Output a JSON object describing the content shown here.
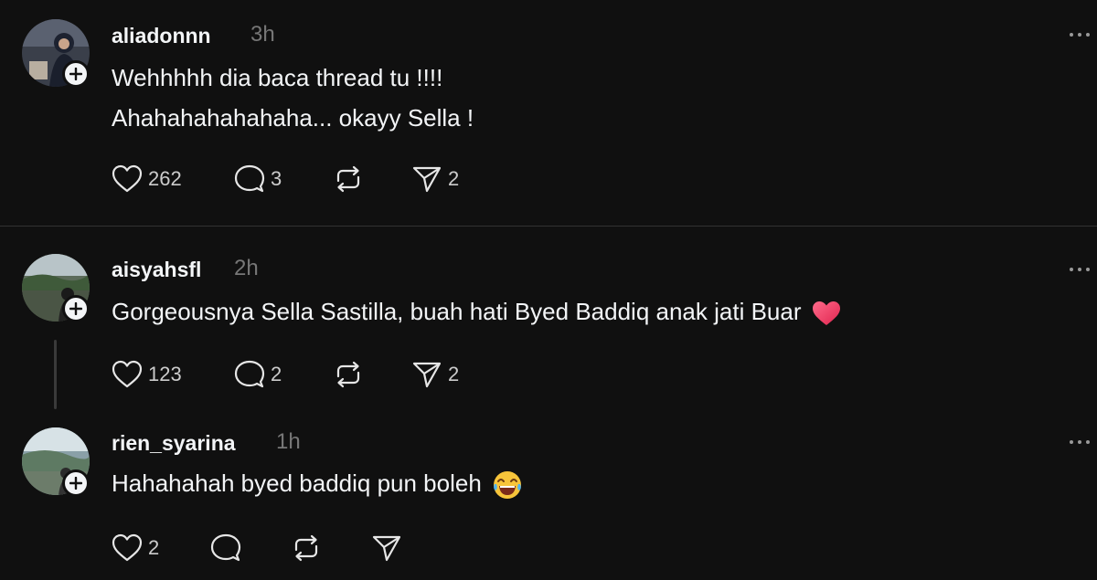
{
  "posts": [
    {
      "username": "aliadonnn",
      "time": "3h",
      "text_lines": [
        "Wehhhhh dia baca thread tu !!!!",
        "Ahahahahahahaha... okayy Sella !"
      ],
      "likes": "262",
      "replies": "3",
      "reposts": "",
      "shares": "2"
    },
    {
      "username": "aisyahsfl",
      "time": "2h",
      "text_lines": [
        "Gorgeousnya Sella Sastilla, buah hati Byed Baddiq anak jati Buar"
      ],
      "emoji": "heart-emoji",
      "likes": "123",
      "replies": "2",
      "reposts": "",
      "shares": "2"
    },
    {
      "username": "rien_syarina",
      "time": "1h",
      "text_lines": [
        "Hahahahah byed baddiq pun boleh"
      ],
      "emoji": "laughing-emoji",
      "likes": "2",
      "replies": "",
      "reposts": "",
      "shares": ""
    }
  ],
  "colors": {
    "background": "#101010",
    "text": "#f3f5f7",
    "muted": "#777777",
    "divider": "#323232",
    "heart_emoji": "#ff3b6b"
  },
  "icons": {
    "like": "heart-outline-icon",
    "reply": "speech-bubble-icon",
    "repost": "repost-arrows-icon",
    "share": "paper-plane-icon",
    "more": "more-dots-icon",
    "follow": "plus-icon"
  }
}
